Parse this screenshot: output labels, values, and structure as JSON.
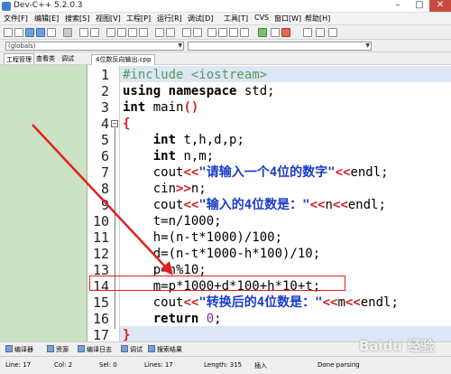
{
  "window": {
    "title": "Dev-C++ 5.2.0.3",
    "minimize": "–",
    "maximize": "□",
    "close": "✕"
  },
  "menu": [
    "文件[F]",
    "编辑[E]",
    "搜索[S]",
    "视图[V]",
    "工程[P]",
    "运行[R]",
    "调试[D]",
    "工具[T]",
    "CVS",
    "窗口[W]",
    "帮助[H]"
  ],
  "toolbar_icons": [
    "new-icon",
    "open-icon",
    "save-icon",
    "save-all-icon",
    "close-icon",
    "print-icon",
    "undo-icon",
    "redo-icon",
    "find-icon",
    "replace-icon",
    "find-next-icon",
    "goto-icon",
    "indent-icon",
    "unindent-icon",
    "toggle-comment-icon",
    "compile-icon",
    "run-icon",
    "compile-run-icon",
    "rebuild-icon",
    "debug-icon",
    "check-icon",
    "stop-icon",
    "new-project-icon",
    "properties-icon",
    "about-icon"
  ],
  "scope_select": {
    "value": "(globals)"
  },
  "member_select": {
    "value": ""
  },
  "left_tabs": [
    "工程管理",
    "查看类",
    "调试"
  ],
  "editor_tab": "4位数反向输出.cpp",
  "line_numbers": [
    "1",
    "2",
    "3",
    "4",
    "5",
    "6",
    "7",
    "8",
    "9",
    "10",
    "11",
    "12",
    "13",
    "14",
    "15",
    "16",
    "17"
  ],
  "fold_marker": "⊟",
  "code": {
    "l1_pp": "#include <iostream>",
    "l2_kw1": "using",
    "l2_kw2": "namespace",
    "l2_rest": " std;",
    "l3_kw": "int",
    "l3_fn": " main",
    "l3_op": "()",
    "l4": "{",
    "l5_kw": "int",
    "l5_rest": " t,h,d,p;",
    "l6_kw": "int",
    "l6_rest": " n,m;",
    "l7_a": "cout",
    "l7_op": "<<",
    "l7_str": "\"请输入一个4位的数字\"",
    "l7_op2": "<<",
    "l7_b": "endl;",
    "l8_a": "cin",
    "l8_op": ">>",
    "l8_b": "n;",
    "l9_a": "cout",
    "l9_op": "<<",
    "l9_str": "\"输入的4位数是：\"",
    "l9_op2": "<<",
    "l9_b": "n",
    "l9_op3": "<<",
    "l9_c": "endl;",
    "l10": "t=n/1000;",
    "l11": "h=(n-t*1000)/100;",
    "l12": "d=(n-t*1000-h*100)/10;",
    "l13": "p=n%10;",
    "l14": "m=p*1000+d*100+h*10+t;",
    "l15_a": "cout",
    "l15_op": "<<",
    "l15_str": "\"转换后的4位数是：\"",
    "l15_op2": "<<",
    "l15_b": "m",
    "l15_op3": "<<",
    "l15_c": "endl;",
    "l16_kw": "return",
    "l16_num": " 0",
    "l16_rest": ";",
    "l17": "}"
  },
  "bottom_tabs": [
    "编译器",
    "资源",
    "编译日志",
    "调试",
    "搜索结果"
  ],
  "status": {
    "line_label": "Line:",
    "line": "17",
    "col_label": "Col:",
    "col": "2",
    "sel_label": "Sel:",
    "sel": "0",
    "lines_label": "Lines:",
    "lines": "17",
    "length_label": "Length:",
    "length": "315",
    "mode": "插入",
    "message": "Done parsing"
  },
  "watermark": "Baidu 经验",
  "colors": {
    "annotation_red": "#e02020",
    "left_panel": "#cbe2c4",
    "string_blue": "#1a3cc8",
    "operator_red": "#d21f1f"
  }
}
